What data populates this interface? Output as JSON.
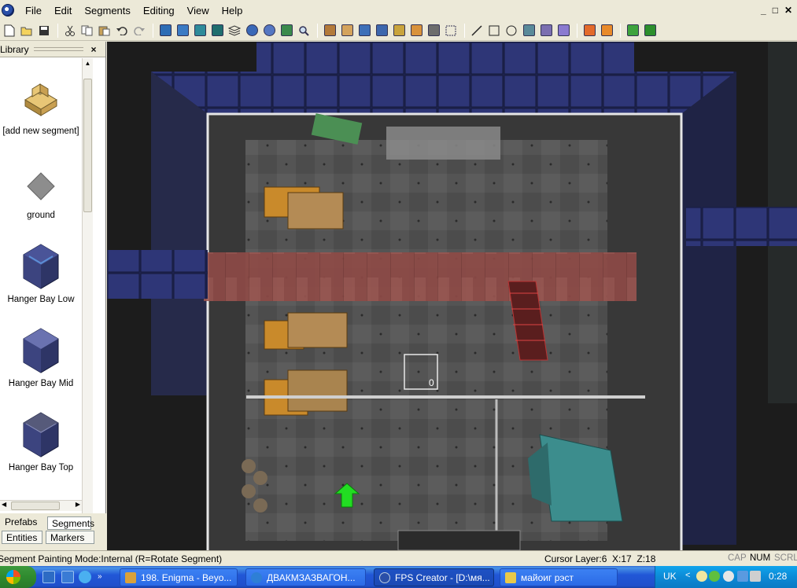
{
  "menu": {
    "items": [
      "File",
      "Edit",
      "Segments",
      "Editing",
      "View",
      "Help"
    ],
    "window_controls": [
      "_",
      "□",
      "✕"
    ]
  },
  "toolbar": {
    "icons": [
      "new-file-icon",
      "open-file-icon",
      "save-icon",
      "cut-icon",
      "copy-icon",
      "paste-icon",
      "undo-icon",
      "redo-icon",
      "view-icon-1",
      "view-icon-2",
      "view-icon-3",
      "view-icon-4",
      "layers-icon",
      "zoom-in-icon",
      "zoom-out-icon",
      "picture-icon",
      "search-icon",
      "hand-icon",
      "eraser-icon",
      "paint-icon",
      "paint-icon-2",
      "brush-icon",
      "brush-icon-2",
      "pick-icon",
      "select-icon",
      "line-icon",
      "rectangle-icon",
      "circle-icon",
      "spray-icon",
      "pencil-icon",
      "pencil-icon-2",
      "flag-icon",
      "flag-icon-2",
      "test-game-icon",
      "build-game-icon"
    ]
  },
  "library": {
    "title": "Library",
    "close": "×",
    "items": [
      {
        "label": "[add new segment]",
        "icon": "add-segment-icon"
      },
      {
        "label": "ground",
        "icon": "ground-icon"
      },
      {
        "label": "Hanger Bay Low",
        "icon": "hangar-low-icon"
      },
      {
        "label": "Hanger Bay Mid",
        "icon": "hangar-mid-icon"
      },
      {
        "label": "Hanger Bay Top",
        "icon": "hangar-top-icon"
      }
    ],
    "tabs": [
      "Prefabs",
      "Segments",
      "Entities",
      "Markers"
    ]
  },
  "viewport": {
    "cursor_box_value": "0"
  },
  "status": {
    "mode": "Segment Painting Mode:Internal (R=Rotate Segment)",
    "cursor": "Cursor Layer:6  X:17  Z:18",
    "indicators": [
      "CAP",
      "NUM",
      "SCRL"
    ]
  },
  "taskbar": {
    "tasks": [
      {
        "label": "198. Enigma - Beyo...",
        "color": "#d9a13b"
      },
      {
        "label": "ДВАКМЗАЗВАГОН...",
        "color": "#2e7fd6"
      },
      {
        "label": "FPS Creator - [D:\\мя...",
        "color": "#2a4fa8"
      },
      {
        "label": "майоиг рэст",
        "color": "#e8c94a"
      }
    ],
    "lang": "UK",
    "time": "0:28"
  }
}
